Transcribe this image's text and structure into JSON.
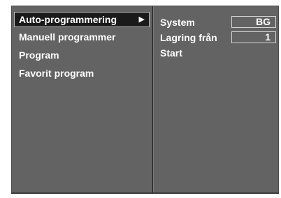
{
  "left_menu": {
    "items": [
      {
        "label": "Auto-programmering",
        "selected": true,
        "arrow": "▶"
      },
      {
        "label": "Manuell programmer"
      },
      {
        "label": "Program"
      },
      {
        "label": "Favorit program"
      }
    ]
  },
  "right_menu": {
    "items": [
      {
        "label": "System",
        "value": "BG"
      },
      {
        "label": "Lagring från",
        "value": "1"
      },
      {
        "label": "Start"
      }
    ]
  }
}
